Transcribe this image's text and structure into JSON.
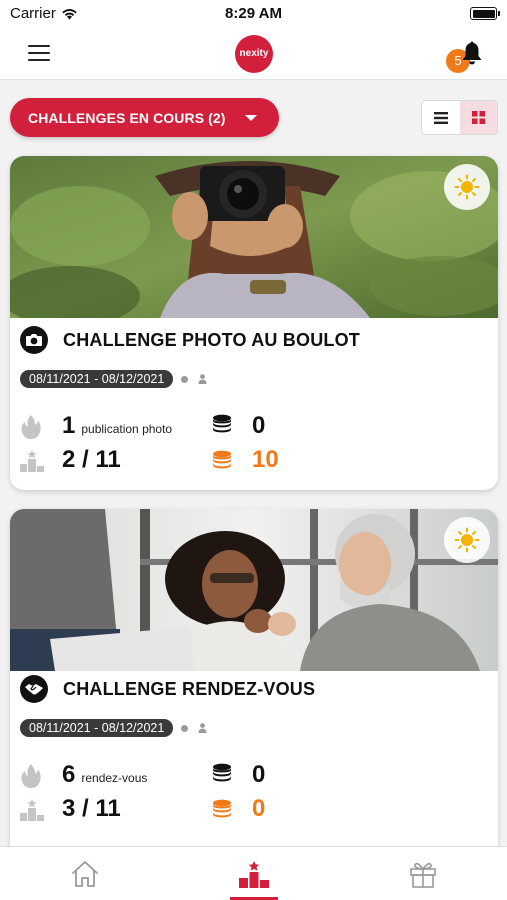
{
  "status_bar": {
    "carrier": "Carrier",
    "time": "8:29 AM"
  },
  "header": {
    "logo_text": "nexity",
    "notification_count": "5"
  },
  "filter": {
    "dropdown_label": "CHALLENGES EN COURS (2)"
  },
  "challenges": [
    {
      "title": "CHALLENGE PHOTO AU BOULOT",
      "dates": "08/11/2021 - 08/12/2021",
      "count": "1",
      "count_unit": "publication photo",
      "rank": "2 / 11",
      "coins": "0",
      "points": "10",
      "category_icon": "camera-icon"
    },
    {
      "title": "CHALLENGE RENDEZ-VOUS",
      "dates": "08/11/2021 - 08/12/2021",
      "count": "6",
      "count_unit": "rendez-vous",
      "rank": "3 / 11",
      "coins": "0",
      "points": "0",
      "category_icon": "handshake-icon"
    }
  ],
  "colors": {
    "brand": "#d21f3c",
    "accent": "#f07a1a"
  },
  "tabs": [
    "home-icon",
    "podium-icon",
    "gift-icon"
  ]
}
